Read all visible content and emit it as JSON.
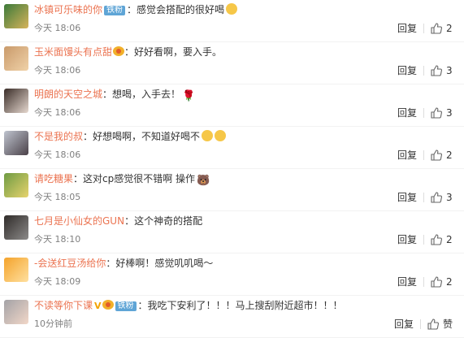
{
  "comments": [
    {
      "name": "冰镇可乐味的你",
      "badge": "铁粉",
      "vip": "",
      "crown": false,
      "text": "：感觉会搭配的很好喝",
      "emoji": "smile",
      "time": "今天 18:06",
      "reply": "回复",
      "likes": "2",
      "avatar_colors": [
        "#3c7a3a",
        "#d6b35a"
      ]
    },
    {
      "name": "玉米面馒头有点甜",
      "badge": "",
      "vip": "",
      "crown": true,
      "text": "：好好看啊，要入手。",
      "emoji": "",
      "time": "今天 18:06",
      "reply": "回复",
      "likes": "3",
      "avatar_colors": [
        "#c99a6b",
        "#f0d2a8"
      ]
    },
    {
      "name": "明朗的天空之城",
      "badge": "",
      "vip": "",
      "crown": false,
      "text": "：想喝，入手去！",
      "emoji": "rose",
      "time": "今天 18:06",
      "reply": "回复",
      "likes": "3",
      "avatar_colors": [
        "#3a2d28",
        "#e6d8cf"
      ]
    },
    {
      "name": "不是我的叔",
      "badge": "",
      "vip": "",
      "crown": false,
      "text": "：好想喝啊，不知道好喝不",
      "emoji": "laugh2",
      "time": "今天 18:06",
      "reply": "回复",
      "likes": "2",
      "avatar_colors": [
        "#bfc4cf",
        "#4a4148"
      ]
    },
    {
      "name": "请吃糖果",
      "badge": "",
      "vip": "",
      "crown": false,
      "text": "：这对cp感觉很不错啊 操作",
      "emoji": "bear",
      "time": "今天 18:05",
      "reply": "回复",
      "likes": "3",
      "avatar_colors": [
        "#6f9b43",
        "#e7d36d"
      ]
    },
    {
      "name": "七月是小仙女的GUN",
      "badge": "",
      "vip": "",
      "crown": false,
      "text": "：这个神奇的搭配",
      "emoji": "",
      "time": "今天 18:10",
      "reply": "回复",
      "likes": "2",
      "avatar_colors": [
        "#2f2b29",
        "#8c8a89"
      ]
    },
    {
      "name": "-会送红豆汤给你",
      "badge": "",
      "vip": "",
      "crown": false,
      "text": "：好棒啊！感觉叽叽喝～",
      "emoji": "",
      "time": "今天 18:09",
      "reply": "回复",
      "likes": "2",
      "avatar_colors": [
        "#f4a32a",
        "#ffe0a0"
      ]
    },
    {
      "name": "不读等你下课",
      "badge": "铁粉",
      "vip": "V",
      "crown": true,
      "text": "：我吃下安利了！！！马上搜刮附近超市！！！",
      "emoji": "",
      "time": "10分钟前",
      "reply": "回复",
      "likes": "赞",
      "avatar_colors": [
        "#a3a2a6",
        "#f2d7c8"
      ]
    }
  ]
}
